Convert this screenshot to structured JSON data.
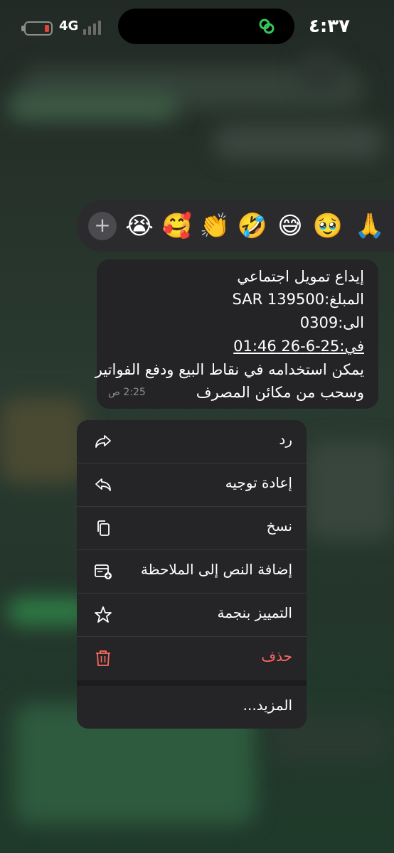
{
  "status_bar": {
    "time": "٤:٣٧",
    "network": "4G",
    "island_icon": "link-rings-icon",
    "battery_color": "#e0443a"
  },
  "reactions": {
    "add_icon": "plus-icon",
    "add_label": "+",
    "emojis": [
      "😭",
      "🥰",
      "👏",
      "🤣",
      "😅",
      "🥹",
      "🙏"
    ]
  },
  "message": {
    "lines": [
      "إيداع تمويل اجتماعي",
      "المبلغ:SAR 139500",
      "الى:0309",
      "في:25-6-26 01:46",
      "يمكن استخدامه في نقاط البيع ودفع الفواتير",
      "وسحب من مكائن المصرف"
    ],
    "time": "2:25 ص"
  },
  "menu": {
    "items": [
      {
        "label": "رد",
        "icon": "reply-arrow-icon"
      },
      {
        "label": "إعادة توجيه",
        "icon": "forward-arrow-icon"
      },
      {
        "label": "نسخ",
        "icon": "copy-icon"
      },
      {
        "label": "إضافة النص إلى الملاحظة",
        "icon": "add-note-icon"
      },
      {
        "label": "التمييز بنجمة",
        "icon": "star-icon"
      },
      {
        "label": "حذف",
        "icon": "trash-icon"
      },
      {
        "label": "المزيد...",
        "icon": ""
      }
    ],
    "danger_color": "#ff6961"
  }
}
